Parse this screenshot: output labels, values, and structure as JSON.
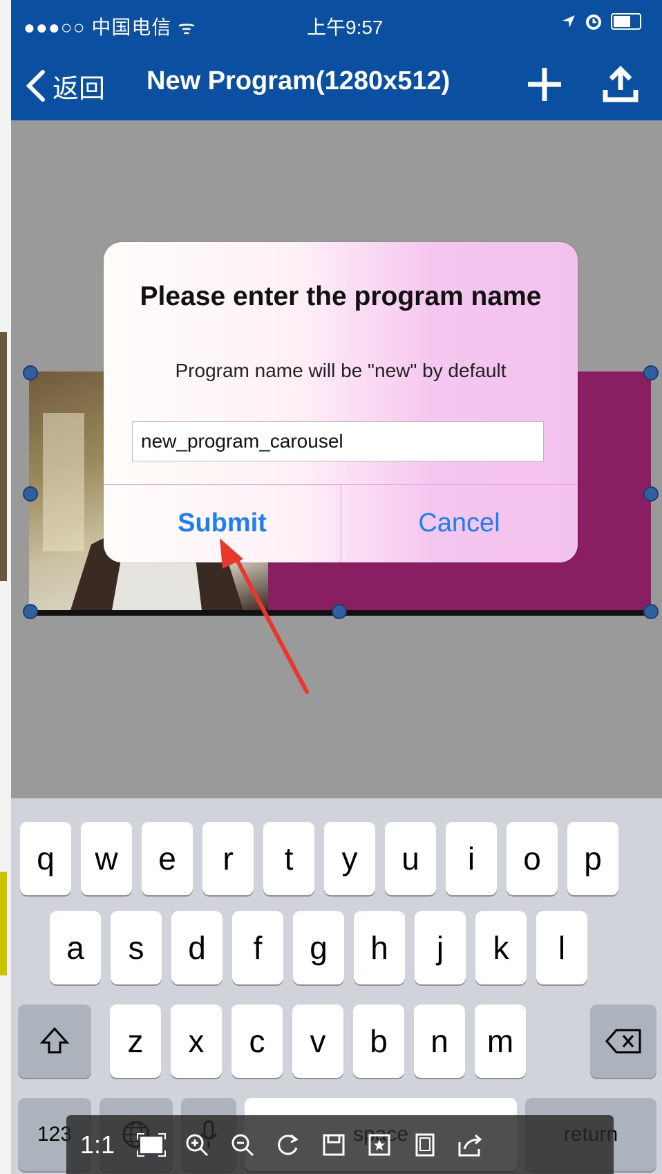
{
  "status_bar": {
    "carrier": "●●●○○ 中国电信 ᯤ",
    "time": "上午9:57",
    "right_icons": [
      "location-arrow-icon",
      "alarm-icon",
      "battery-icon"
    ]
  },
  "nav": {
    "back_label": "返回",
    "title": "New Program(1280x512)"
  },
  "alert": {
    "title": "Please enter the program name",
    "subtitle": "Program name will be \"new\" by default",
    "input_value": "new_program_carousel",
    "submit_label": "Submit",
    "cancel_label": "Cancel"
  },
  "keyboard": {
    "row1": [
      "q",
      "w",
      "e",
      "r",
      "t",
      "y",
      "u",
      "i",
      "o",
      "p"
    ],
    "row2": [
      "a",
      "s",
      "d",
      "f",
      "g",
      "h",
      "j",
      "k",
      "l"
    ],
    "row3": [
      "z",
      "x",
      "c",
      "v",
      "b",
      "n",
      "m"
    ],
    "numbers_label": "123",
    "space_label": "space",
    "return_label": "return"
  },
  "viewer_toolbar": {
    "ratio_label": "1:1",
    "icons": [
      "fit-screen-icon",
      "zoom-in-icon",
      "zoom-out-icon",
      "rotate-icon",
      "save-icon",
      "bookmark-icon",
      "fullscreen-icon",
      "share-icon"
    ]
  },
  "colors": {
    "nav_blue": "#0b4fa1",
    "canvas_grey": "#9a9a9a",
    "magenta": "#8a1e62",
    "button_blue": "#1e7ff0",
    "annotation_red": "#e8382e"
  }
}
